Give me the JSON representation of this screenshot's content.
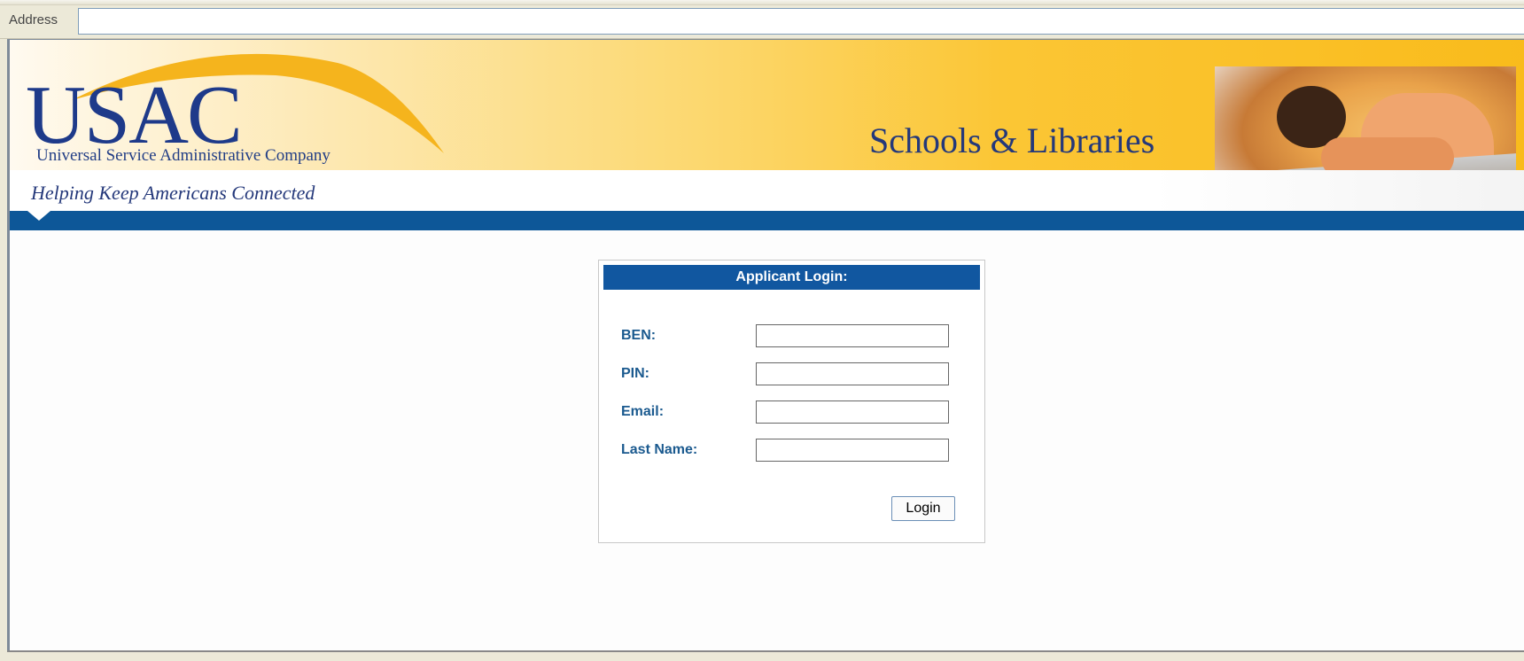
{
  "browser": {
    "address_label": "Address",
    "address_value": ""
  },
  "header": {
    "logo_text": "USAC",
    "company_name": "Universal Service Administrative Company",
    "tagline": "Helping Keep Americans Connected",
    "program_title": "Schools & Libraries"
  },
  "login": {
    "title": "Applicant Login:",
    "fields": [
      {
        "label": "BEN:",
        "value": ""
      },
      {
        "label": "PIN:",
        "value": ""
      },
      {
        "label": "Email:",
        "value": ""
      },
      {
        "label": "Last Name:",
        "value": ""
      }
    ],
    "button_label": "Login"
  },
  "colors": {
    "brand_blue": "#1157a0",
    "band_blue": "#0d5798",
    "label_blue": "#1b5a8f",
    "header_gold": "#f9bb1b"
  }
}
